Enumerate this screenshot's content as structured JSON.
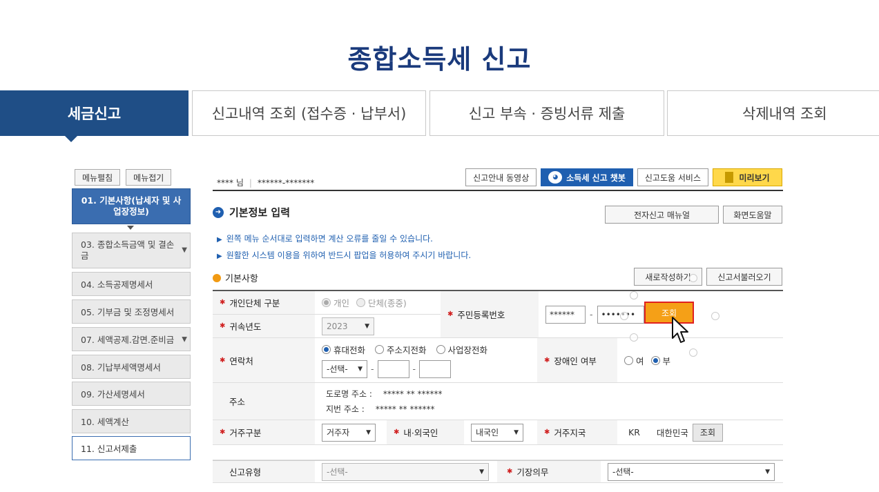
{
  "page_title": "종합소득세 신고",
  "tabs": [
    {
      "label": "세금신고"
    },
    {
      "label": "신고내역 조회 (접수증 · 납부서)"
    },
    {
      "label": "신고 부속 · 증빙서류 제출"
    },
    {
      "label": "삭제내역 조회"
    }
  ],
  "menu": {
    "expand_label": "메뉴펼침",
    "collapse_label": "메뉴접기"
  },
  "sidebar": {
    "items": [
      {
        "label": "01. 기본사항(납세자 및 사업장정보)"
      },
      {
        "label": "03. 종합소득금액 및 결손금"
      },
      {
        "label": "04. 소득공제명세서"
      },
      {
        "label": "05. 기부금 및 조정명세서"
      },
      {
        "label": "07. 세액공제.감면.준비금"
      },
      {
        "label": "08. 기납부세액명세서"
      },
      {
        "label": "09. 가산세명세서"
      },
      {
        "label": "10. 세액계산"
      },
      {
        "label": "11. 신고서제출"
      }
    ]
  },
  "user": {
    "name": "**** 님",
    "id": "******-*******"
  },
  "top_buttons": {
    "video": "신고안내 동영상",
    "chatbot": "소득세 신고 챗봇",
    "help_service": "신고도움 서비스",
    "preview": "미리보기"
  },
  "section": {
    "title": "기본정보 입력",
    "manual_button": "전자신고 매뉴얼",
    "screen_help_button": "화면도움말"
  },
  "notices": [
    "왼쪽 메뉴 순서대로 입력하면 계산 오류를 줄일 수 있습니다.",
    "원활한 시스템 이용을 위하여 반드시 팝업을 허용하여 주시기 바랍니다."
  ],
  "basic": {
    "title": "기본사항",
    "new_button": "새로작성하기",
    "load_button": "신고서불러오기"
  },
  "form": {
    "type_label": "개인단체 구분",
    "type_opt_individual": "개인",
    "type_opt_group": "단체(종중)",
    "year_label": "귀속년도",
    "year_value": "2023",
    "rrn_label": "주민등록번호",
    "rrn_front": "******",
    "rrn_dash": "-",
    "rrn_back": "•••••••",
    "search_button": "조회",
    "contact_label": "연락처",
    "contact_opt_mobile": "휴대전화",
    "contact_opt_home": "주소지전화",
    "contact_opt_business": "사업장전화",
    "phone_select": "-선택-",
    "phone_dash1": "-",
    "phone_dash2": "-",
    "disabled_label": "장애인 여부",
    "disabled_yes": "여",
    "disabled_no": "부",
    "address_label": "주소",
    "road_address_label": "도로명 주소 :",
    "road_address_value": "*****  **  ******",
    "lot_address_label": "지번 주소 :",
    "lot_address_value": "*****  **  ******",
    "residence_type_label": "거주구분",
    "residence_type_value": "거주자",
    "nationality_label": "내·외국인",
    "nationality_value": "내국인",
    "residence_country_label": "거주지국",
    "country_code": "KR",
    "country_name": "대한민국",
    "country_search_button": "조회",
    "report_type_label": "신고유형",
    "report_type_value": "-선택-",
    "bookkeeping_label": "기장의무",
    "bookkeeping_value": "-선택-"
  }
}
